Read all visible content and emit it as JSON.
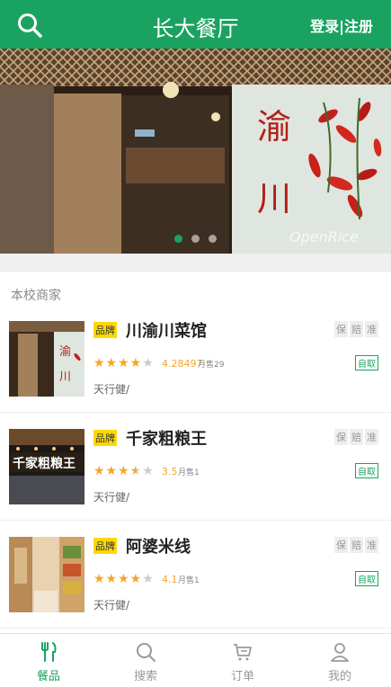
{
  "header": {
    "title": "长大餐厅",
    "login_label": "登录|注册"
  },
  "banner": {
    "sign_text_1": "渝",
    "sign_text_2": "川",
    "watermark": "OpenRice",
    "slide_count": 3,
    "active_slide": 1
  },
  "section": {
    "title": "本校商家"
  },
  "shops": [
    {
      "brand_badge": "品牌",
      "name": "川渝川菜馆",
      "tags": [
        "保",
        "赔",
        "准"
      ],
      "rating": 4.28497,
      "rating_text": "4.28497",
      "sales": "月售29",
      "pickup": "自取",
      "owner": "天行健/"
    },
    {
      "brand_badge": "品牌",
      "name": "千家粗粮王",
      "tags": [
        "保",
        "赔",
        "准"
      ],
      "rating": 3.5,
      "rating_text": "3.5",
      "sales": "月售1",
      "pickup": "自取",
      "owner": "天行健/"
    },
    {
      "brand_badge": "品牌",
      "name": "阿婆米线",
      "tags": [
        "保",
        "赔",
        "准"
      ],
      "rating": 4.1,
      "rating_text": "4.1",
      "sales": "月售1",
      "pickup": "自取",
      "owner": "天行健/"
    }
  ],
  "tabbar": {
    "items": [
      {
        "label": "餐品",
        "icon": "utensils-icon",
        "active": true
      },
      {
        "label": "搜索",
        "icon": "search-icon",
        "active": false
      },
      {
        "label": "订单",
        "icon": "cart-icon",
        "active": false
      },
      {
        "label": "我的",
        "icon": "user-icon",
        "active": false
      }
    ]
  },
  "colors": {
    "brand_green": "#1aa260",
    "star": "#f5a623",
    "badge_yellow": "#ffd800"
  }
}
